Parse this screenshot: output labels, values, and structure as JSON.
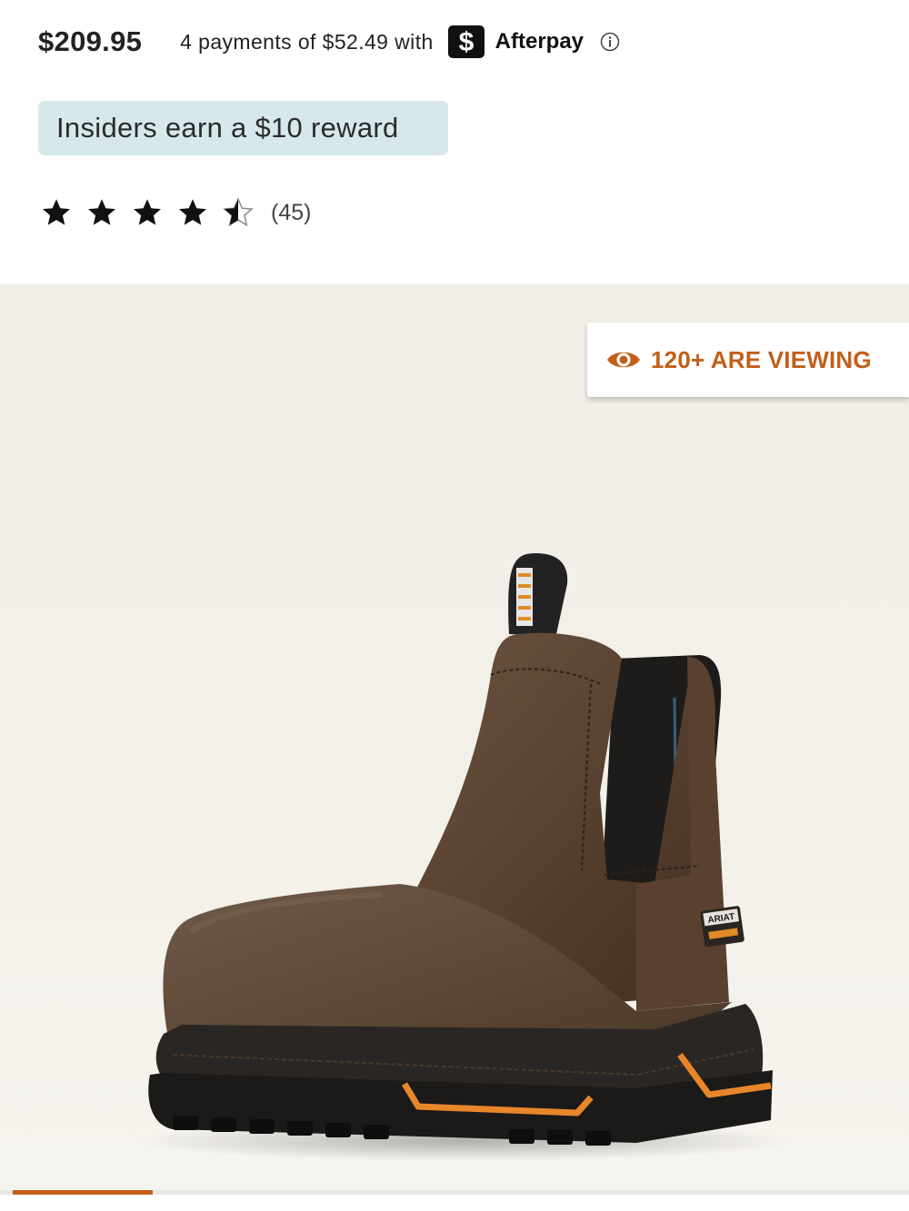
{
  "price": "$209.95",
  "afterpay": {
    "text": "4 payments of $52.49 with",
    "logo_glyph": "$",
    "name": "Afterpay",
    "info_icon": "info-icon"
  },
  "insider": {
    "text": "Insiders earn a $10 reward"
  },
  "rating": {
    "stars": 4.5,
    "max_stars": 5,
    "count": "(45)"
  },
  "gallery": {
    "viewing_text": "120+ ARE VIEWING",
    "boot_label": "ARIAT",
    "progress": 0.154
  },
  "colors": {
    "accent": "#c25f1a",
    "badge_bg": "#d7e8ec",
    "text": "#222222"
  }
}
